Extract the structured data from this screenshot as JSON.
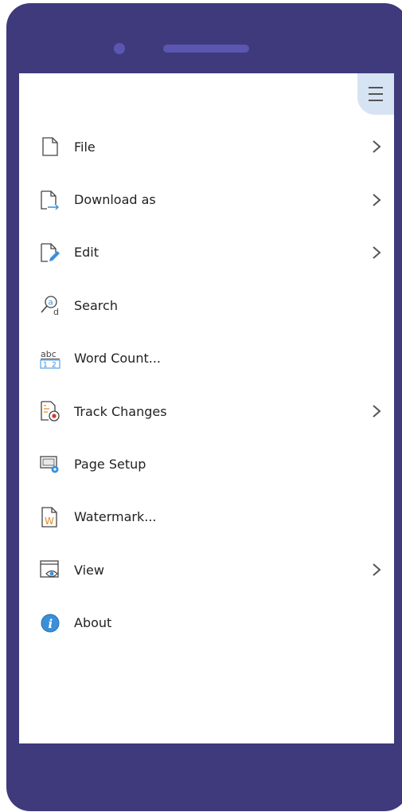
{
  "menu": {
    "items": [
      {
        "label": "File",
        "icon": "file-icon",
        "submenu": true
      },
      {
        "label": "Download as",
        "icon": "download-icon",
        "submenu": true
      },
      {
        "label": "Edit",
        "icon": "edit-icon",
        "submenu": true
      },
      {
        "label": "Search",
        "icon": "search-icon",
        "submenu": false
      },
      {
        "label": "Word Count...",
        "icon": "word-count-icon",
        "submenu": false
      },
      {
        "label": "Track Changes",
        "icon": "track-changes-icon",
        "submenu": true
      },
      {
        "label": "Page Setup",
        "icon": "page-setup-icon",
        "submenu": false
      },
      {
        "label": "Watermark...",
        "icon": "watermark-icon",
        "submenu": false
      },
      {
        "label": "View",
        "icon": "view-icon",
        "submenu": true
      },
      {
        "label": "About",
        "icon": "about-icon",
        "submenu": false
      }
    ]
  },
  "colors": {
    "frame": "#3f3a7c",
    "accent_blue": "#3a8fd8",
    "hamburger_bg": "#d6e3f3"
  }
}
